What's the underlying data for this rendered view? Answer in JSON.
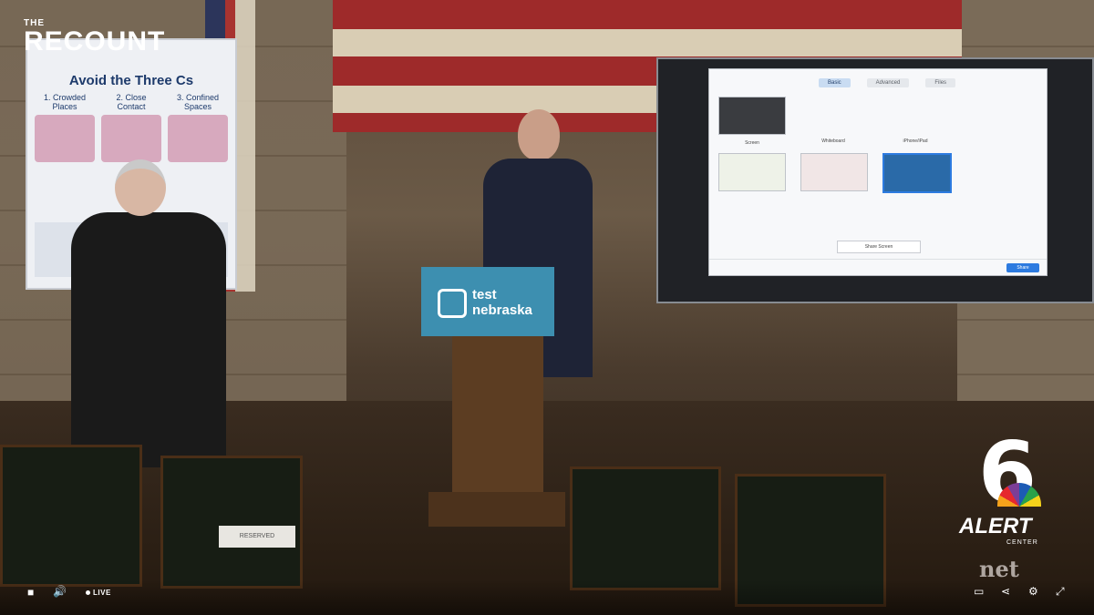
{
  "brand": {
    "small": "THE",
    "main": "RECOUNT"
  },
  "poster": {
    "title": "Avoid the Three Cs",
    "items": [
      {
        "num": "1.",
        "label": "Crowded Places"
      },
      {
        "num": "2.",
        "label": "Close Contact"
      },
      {
        "num": "3.",
        "label": "Confined Spaces"
      }
    ]
  },
  "podium": {
    "line1": "test",
    "line2": "nebraska"
  },
  "share_window": {
    "tabs": [
      "Basic",
      "Advanced",
      "Files"
    ],
    "thumbs": [
      "Screen",
      "Whiteboard",
      "iPhone/iPad",
      "",
      "",
      ""
    ],
    "share_bar": "Share Screen",
    "share_button": "Share"
  },
  "affiliate": {
    "number": "6",
    "alert": "ALERT",
    "center": "CENTER",
    "network_bug": "net"
  },
  "player": {
    "live": "LIVE",
    "icons": [
      "stop-icon",
      "volume-icon",
      "cc-icon",
      "share-icon",
      "settings-icon",
      "fullscreen-icon"
    ]
  },
  "scene_sign": "RESERVED"
}
